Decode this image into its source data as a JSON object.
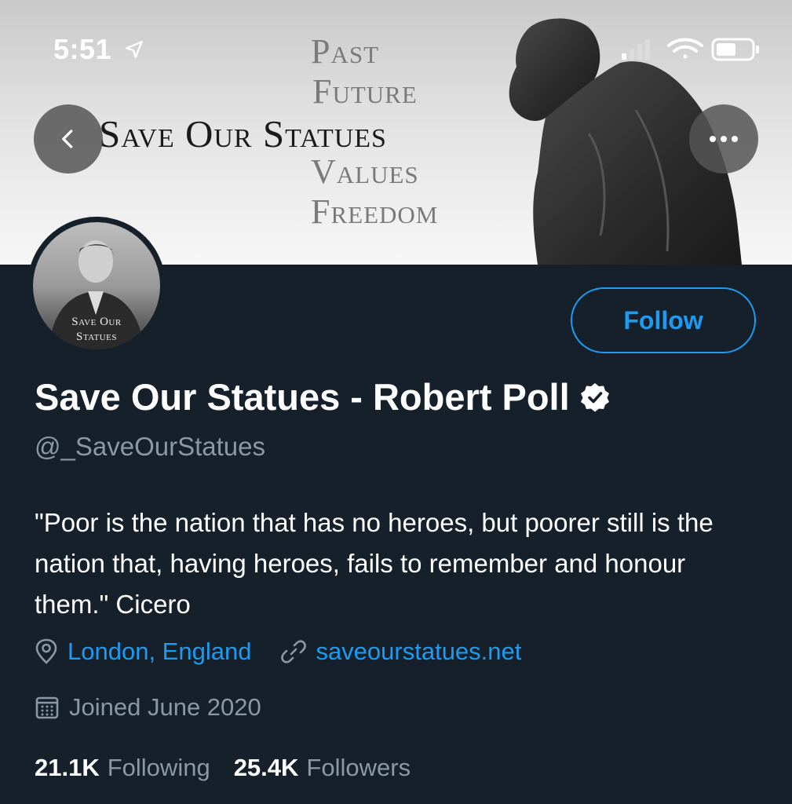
{
  "status_bar": {
    "time": "5:51"
  },
  "banner": {
    "title": "Save Our Statues",
    "words": [
      "Past",
      "Future",
      "Values",
      "Freedom"
    ]
  },
  "avatar": {
    "caption_line1": "Save Our",
    "caption_line2": "Statues"
  },
  "profile": {
    "display_name": "Save Our Statues - Robert Poll",
    "handle": "@_SaveOurStatues",
    "bio": "\"Poor is the nation that has no heroes, but poorer still is the nation that, having heroes, fails to remember and honour them.\" Cicero",
    "location": "London, England",
    "website": "saveourstatues.net",
    "joined": "Joined June 2020",
    "following_count": "21.1K",
    "following_label": "Following",
    "followers_count": "25.4K",
    "followers_label": "Followers"
  },
  "actions": {
    "follow_label": "Follow"
  },
  "icons": {
    "back": "chevron-left-icon",
    "more": "more-horizontal-icon",
    "verified": "verified-badge-icon",
    "location": "location-pin-icon",
    "link": "link-icon",
    "calendar": "calendar-icon"
  },
  "colors": {
    "background": "#15202b",
    "accent": "#1d9bf0",
    "secondary_text": "#8b98a5"
  }
}
